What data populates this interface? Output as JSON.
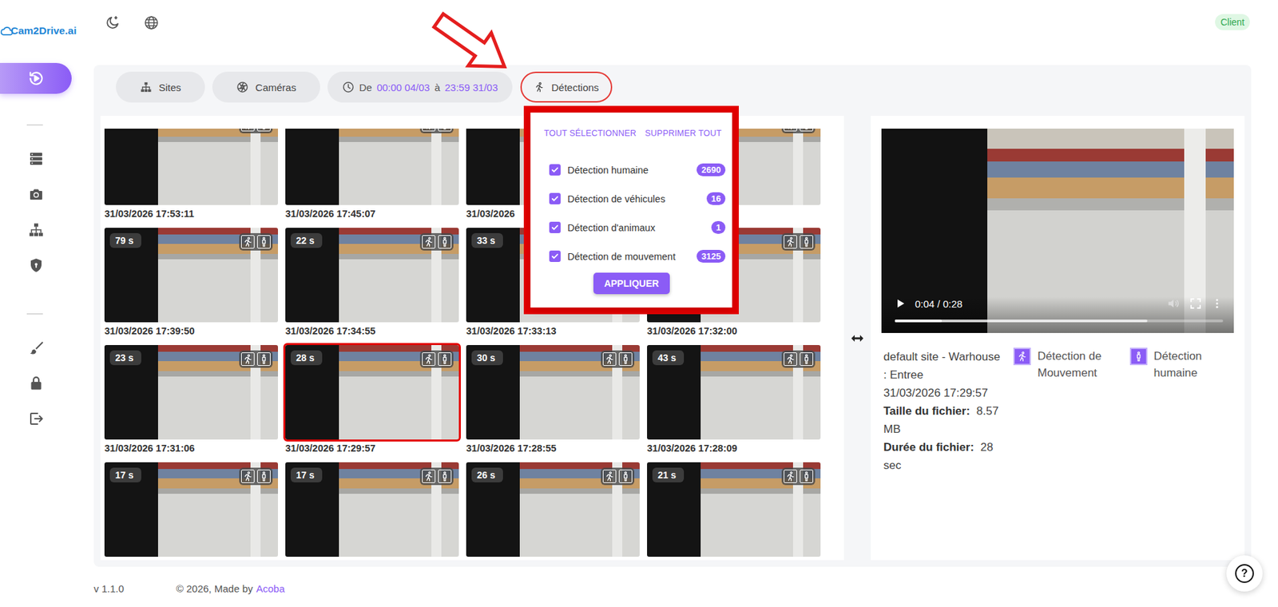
{
  "app": {
    "logo": "Cam2Drive.ai",
    "role_badge": "Client"
  },
  "sidebar": {
    "items": [
      {
        "kind": "button",
        "selected": true
      },
      {
        "kind": "divider"
      },
      {
        "kind": "button",
        "selected": false
      },
      {
        "kind": "button",
        "selected": false
      },
      {
        "kind": "button",
        "selected": false
      },
      {
        "kind": "button",
        "selected": false
      },
      {
        "kind": "divider"
      },
      {
        "kind": "button",
        "selected": false
      },
      {
        "kind": "button",
        "selected": false
      },
      {
        "kind": "button",
        "selected": false
      }
    ]
  },
  "filters": {
    "sites": {
      "label": "Sites",
      "open": false
    },
    "cameras": {
      "label": "Caméras",
      "open": false
    },
    "period": {
      "from_label": "De",
      "from": "00:00 04/03",
      "to_label": "à",
      "to": "23:59 31/03"
    },
    "detections": {
      "label": "Détections",
      "open": true
    }
  },
  "detection_menu": {
    "select_all": "TOUT SÉLECTIONNER",
    "clear_all": "SUPPRIMER TOUT",
    "options": [
      {
        "label": "Détection humaine",
        "count": "2690",
        "checked": true
      },
      {
        "label": "Détection de véhicules",
        "count": "16",
        "checked": true
      },
      {
        "label": "Détection d'animaux",
        "count": "1",
        "checked": true
      },
      {
        "label": "Détection de mouvement",
        "count": "3125",
        "checked": true
      }
    ],
    "apply": "APPLIQUER"
  },
  "recordings": [
    {
      "time": "31/03/2026 17:53:11",
      "selected": false
    },
    {
      "time": "31/03/2026 17:45:07",
      "selected": false
    },
    {
      "time": "31/03/2026",
      "selected": false
    },
    {
      "selected": false
    },
    {
      "time": "31/03/2026 17:39:50",
      "duration": "79 s",
      "selected": false
    },
    {
      "time": "31/03/2026 17:34:55",
      "duration": "22 s",
      "selected": false
    },
    {
      "time": "31/03/2026 17:33:13",
      "duration": "33 s",
      "selected": false
    },
    {
      "time": "31/03/2026 17:32:00",
      "selected": false
    },
    {
      "time": "31/03/2026 17:31:06",
      "duration": "23 s",
      "selected": false
    },
    {
      "time": "31/03/2026 17:29:57",
      "duration": "28 s",
      "selected": true
    },
    {
      "time": "31/03/2026 17:28:55",
      "duration": "30 s",
      "selected": false
    },
    {
      "time": "31/03/2026 17:28:09",
      "duration": "43 s",
      "selected": false
    },
    {
      "duration": "17 s",
      "selected": false
    },
    {
      "duration": "17 s",
      "selected": false
    },
    {
      "duration": "26 s",
      "selected": false
    },
    {
      "duration": "21 s",
      "selected": false
    }
  ],
  "player": {
    "time": "0:04 / 0:28",
    "level": 0.143,
    "buffered": 0.77
  },
  "details": {
    "location": "default site - Warhouse : Entree",
    "datetime": "31/03/2026 17:29:57",
    "fields": [
      {
        "label": "Taille du fichier:",
        "value": "8.57 MB"
      },
      {
        "label": "Durée du fichier:",
        "value": "28 sec"
      }
    ],
    "tags": [
      "Détection de Mouvement",
      "Détection humaine"
    ]
  },
  "help": {
    "label": "?"
  },
  "footer": {
    "version": "v 1.1.0",
    "copyright": "© 2026, Made by",
    "link": "Acoba"
  }
}
